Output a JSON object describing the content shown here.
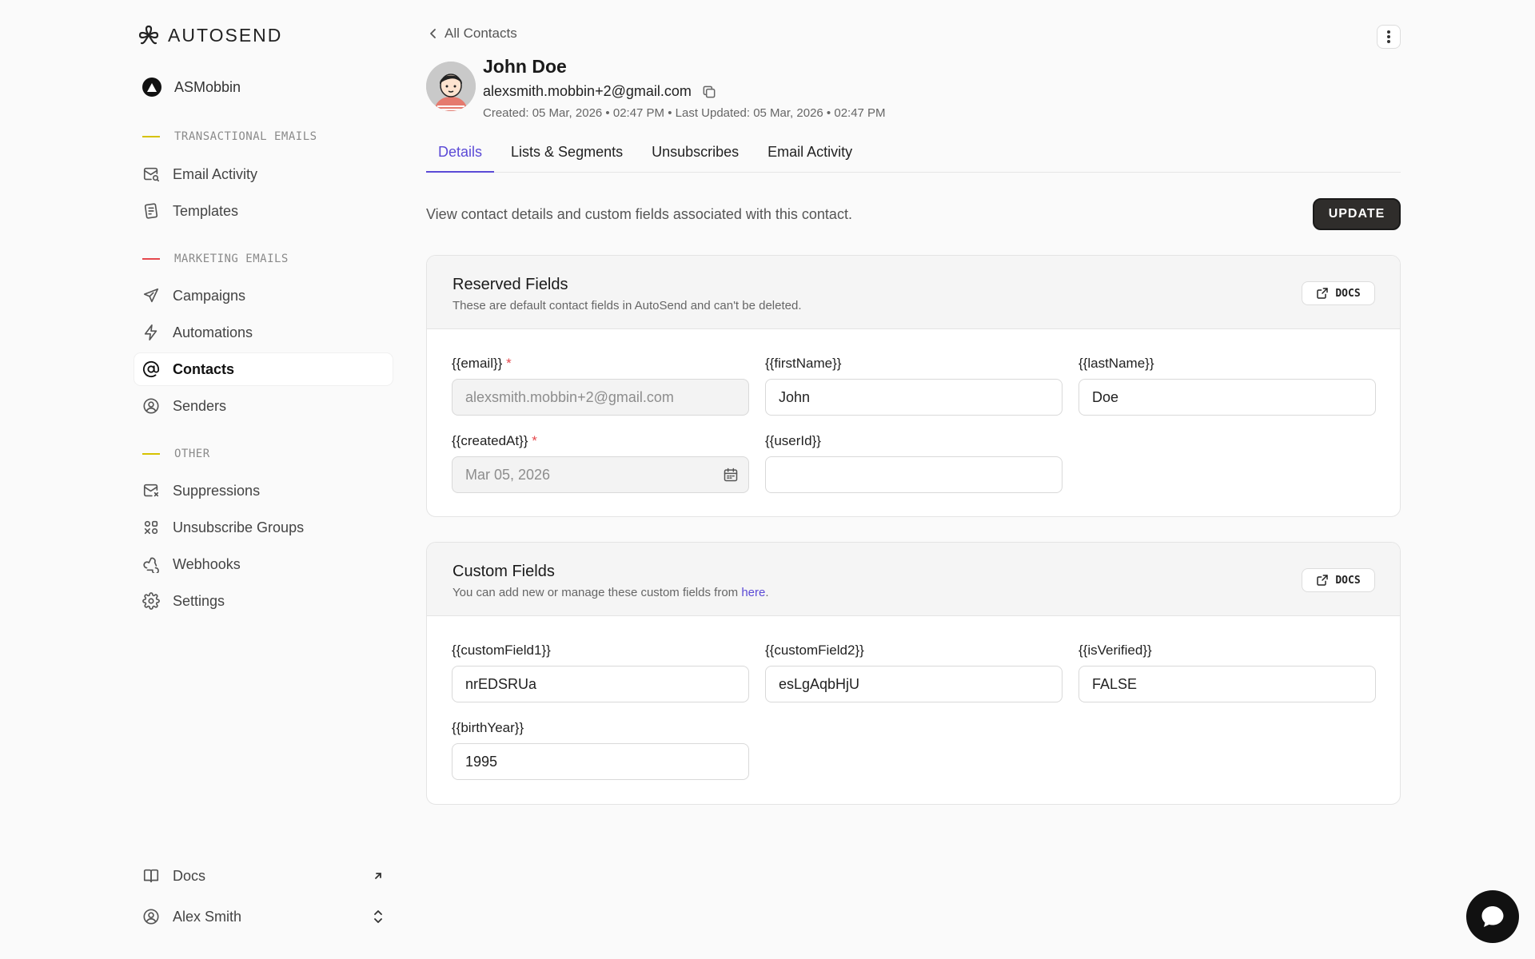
{
  "app": {
    "brand": "AUTOSEND"
  },
  "workspace": {
    "name": "ASMobbin"
  },
  "sidebar": {
    "sections": [
      {
        "label": "TRANSACTIONAL EMAILS",
        "color": "#d6c200"
      },
      {
        "label": "MARKETING EMAILS",
        "color": "#e5484d"
      },
      {
        "label": "OTHER",
        "color": "#d6c200"
      }
    ],
    "items": [
      {
        "label": "Email Activity",
        "icon": "mail-search-icon"
      },
      {
        "label": "Templates",
        "icon": "templates-icon"
      },
      {
        "label": "Campaigns",
        "icon": "send-icon"
      },
      {
        "label": "Automations",
        "icon": "bolt-icon"
      },
      {
        "label": "Contacts",
        "icon": "at-icon"
      },
      {
        "label": "Senders",
        "icon": "user-circle-icon"
      },
      {
        "label": "Suppressions",
        "icon": "mail-x-icon"
      },
      {
        "label": "Unsubscribe Groups",
        "icon": "groups-icon"
      },
      {
        "label": "Webhooks",
        "icon": "webhook-icon"
      },
      {
        "label": "Settings",
        "icon": "gear-icon"
      }
    ],
    "bottom": {
      "docs": "Docs",
      "user": "Alex Smith"
    }
  },
  "header": {
    "back_label": "All Contacts",
    "name": "John Doe",
    "email": "alexsmith.mobbin+2@gmail.com",
    "meta": "Created: 05 Mar, 2026 • 02:47 PM • Last Updated: 05 Mar, 2026 • 02:47 PM"
  },
  "tabs": [
    {
      "label": "Details",
      "active": true
    },
    {
      "label": "Lists & Segments"
    },
    {
      "label": "Unsubscribes"
    },
    {
      "label": "Email Activity"
    }
  ],
  "main": {
    "description": "View contact details and custom fields associated with this contact.",
    "update_label": "UPDATE"
  },
  "reserved": {
    "title": "Reserved Fields",
    "subtitle": "These are default contact fields in AutoSend and can't be deleted.",
    "docs_label": "DOCS",
    "fields": {
      "email": {
        "label": "{{email}}",
        "required": "*",
        "value": "alexsmith.mobbin+2@gmail.com"
      },
      "firstName": {
        "label": "{{firstName}}",
        "value": "John"
      },
      "lastName": {
        "label": "{{lastName}}",
        "value": "Doe"
      },
      "createdAt": {
        "label": "{{createdAt}}",
        "required": "*",
        "value": "Mar 05, 2026"
      },
      "userId": {
        "label": "{{userId}}",
        "value": ""
      }
    }
  },
  "custom": {
    "title": "Custom Fields",
    "subtitle_prefix": "You can add new or manage these custom fields from ",
    "subtitle_link": "here",
    "subtitle_suffix": ".",
    "docs_label": "DOCS",
    "fields": {
      "customField1": {
        "label": "{{customField1}}",
        "value": "nrEDSRUa"
      },
      "customField2": {
        "label": "{{customField2}}",
        "value": "esLgAqbHjU"
      },
      "isVerified": {
        "label": "{{isVerified}}",
        "value": "FALSE"
      },
      "birthYear": {
        "label": "{{birthYear}}",
        "value": "1995"
      }
    }
  },
  "colors": {
    "accent": "#5b4ad6",
    "required": "#e5484d",
    "button_dark": "#2f2d2b"
  }
}
